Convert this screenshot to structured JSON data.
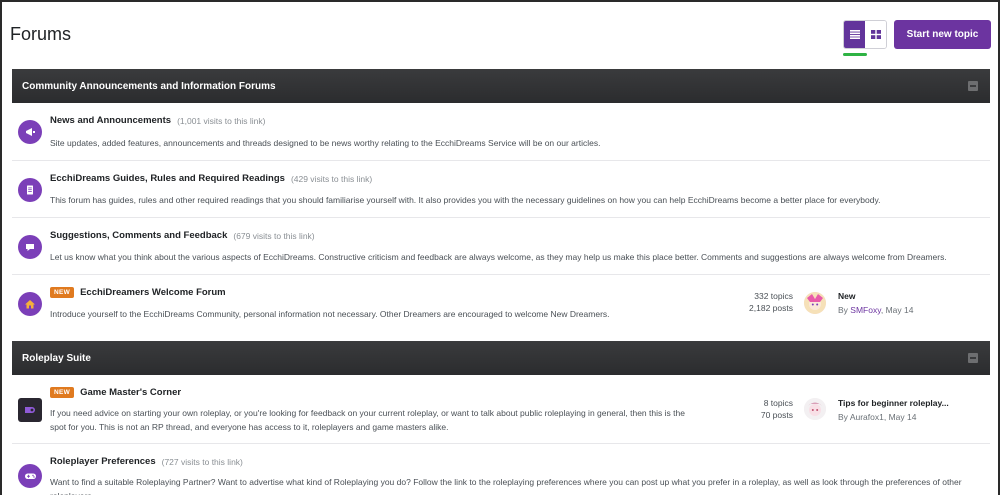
{
  "page": {
    "title": "Forums",
    "start_topic_label": "Start new topic",
    "colors": {
      "accent": "#6c34a0",
      "toggle_active": "#62349b",
      "underline": "#2fb344",
      "badge": "#e07a1f"
    }
  },
  "categories": [
    {
      "name": "Community Announcements and Information Forums",
      "forums": [
        {
          "title": "News and Announcements",
          "visits": "(1,001 visits to this link)",
          "description": "Site updates, added features, announcements and threads designed to be news worthy relating to the EcchiDreams Service will be on our articles.",
          "icon": "megaphone-icon"
        },
        {
          "title": "EcchiDreams Guides, Rules and Required Readings",
          "visits": "(429 visits to this link)",
          "description": "This forum has guides, rules and other required readings that you should familiarise yourself with. It also provides you with the necessary guidelines on how you can help EcchiDreams become a better place for everybody.",
          "icon": "document-icon"
        },
        {
          "title": "Suggestions, Comments and Feedback",
          "visits": "(679 visits to this link)",
          "description": "Let us know what you think about the various aspects of EcchiDreams. Constructive criticism and feedback are always welcome, as they may help us make this place better. Comments and suggestions are always welcome from Dreamers.",
          "icon": "comment-icon"
        },
        {
          "badge": "NEW",
          "title": "EcchiDreamers Welcome Forum",
          "description": "Introduce yourself to the EcchiDreams Community, personal information not necessary. Other Dreamers are encouraged to welcome New Dreamers.",
          "topics": "332 topics",
          "posts": "2,182 posts",
          "last_post": {
            "title": "New",
            "by": "By",
            "author": "SMFoxy",
            "date": ", May 14"
          },
          "icon": "home-icon"
        }
      ]
    },
    {
      "name": "Roleplay Suite",
      "forums": [
        {
          "badge": "NEW",
          "title": "Game Master's Corner",
          "description": "If you need advice on starting your own roleplay, or you're looking for feedback on your current roleplay, or want to talk about public roleplaying in general, then this is the spot for you. This is not an RP thread, and everyone has access to it, roleplayers and game masters alike.",
          "topics": "8 topics",
          "posts": "70 posts",
          "last_post": {
            "title": "Tips for beginner roleplay...",
            "by": "By",
            "author": "Aurafox1",
            "date": ", May 14"
          },
          "icon": "game-master-icon"
        },
        {
          "title": "Roleplayer Preferences",
          "visits": "(727 visits to this link)",
          "description": "Want to find a suitable Roleplaying Partner? Want to advertise what kind of Roleplaying you do? Follow the link to the roleplaying preferences where you can post up what you prefer in a roleplay, as well as look through the preferences of other roleplayers.",
          "icon": "gamepad-icon"
        }
      ]
    }
  ]
}
